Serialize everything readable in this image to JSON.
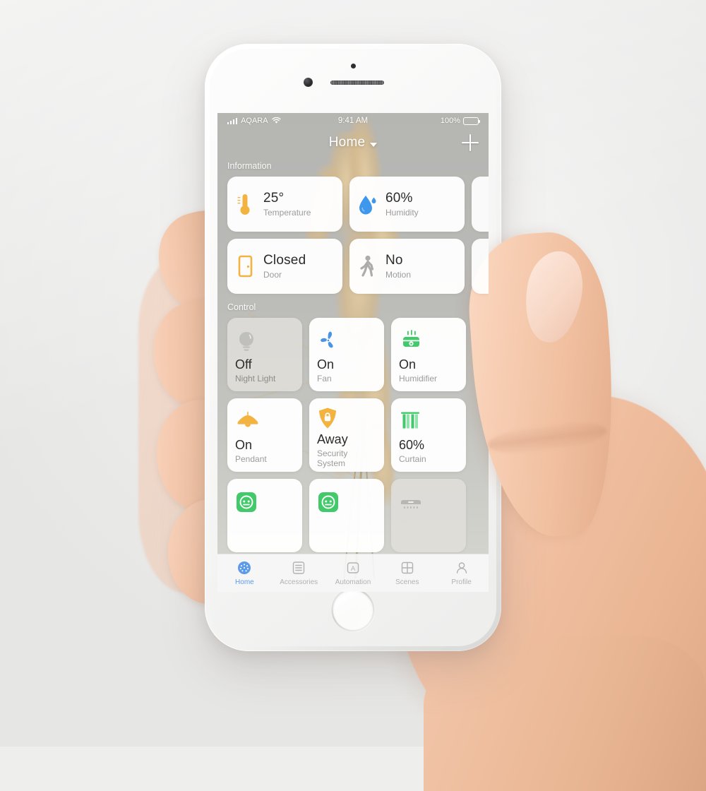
{
  "scene": {
    "device": "iphone-in-hand",
    "description": "Hand holding a white iPhone displaying the Aqara Home smart-home app"
  },
  "status_bar": {
    "carrier": "AQARA",
    "wifi_icon": "wifi-icon",
    "signal_icon": "signal-bars-icon",
    "time": "9:41 AM",
    "battery_percent": "100%",
    "battery_icon": "battery-full-icon"
  },
  "nav_bar": {
    "title": "Home",
    "caret_icon": "chevron-down-icon",
    "add_icon": "plus-icon"
  },
  "sections": [
    {
      "key": "information",
      "label": "Information",
      "rows": [
        [
          {
            "icon": "thermometer-icon",
            "color": "#F3B340",
            "value": "25°",
            "label": "Temperature"
          },
          {
            "icon": "water-drop-icon",
            "color": "#3C97ED",
            "value": "60%",
            "label": "Humidity"
          }
        ],
        [
          {
            "icon": "door-icon",
            "color": "#F3B340",
            "value": "Closed",
            "label": "Door"
          },
          {
            "icon": "motion-walking-icon",
            "color": "#ACACAC",
            "value": "No",
            "label": "Motion"
          }
        ]
      ]
    },
    {
      "key": "control",
      "label": "Control",
      "rows": [
        [
          {
            "icon": "light-bulb-icon",
            "color": "#BFBFBC",
            "value": "Off",
            "label": "Night Light",
            "state": "off"
          },
          {
            "icon": "fan-icon",
            "color": "#4A94E8",
            "value": "On",
            "label": "Fan",
            "state": "on"
          },
          {
            "icon": "humidifier-icon",
            "color": "#41C96A",
            "value": "On",
            "label": "Humidifier",
            "state": "on"
          }
        ],
        [
          {
            "icon": "pendant-lamp-icon",
            "color": "#F3B340",
            "value": "On",
            "label": "Pendant",
            "state": "on"
          },
          {
            "icon": "shield-lock-icon",
            "color": "#F3B340",
            "value": "Away",
            "label": "Security System",
            "state": "on"
          },
          {
            "icon": "curtain-icon",
            "color": "#41C96A",
            "value": "60%",
            "label": "Curtain",
            "state": "on"
          }
        ],
        [
          {
            "icon": "power-outlet-icon",
            "color": "#41C96A",
            "value": "",
            "label": "",
            "state": "on"
          },
          {
            "icon": "power-outlet-icon",
            "color": "#41C96A",
            "value": "",
            "label": "",
            "state": "on"
          },
          {
            "icon": "gateway-hub-icon",
            "color": "#B7B7B4",
            "value": "",
            "label": "",
            "state": "off"
          }
        ]
      ]
    }
  ],
  "tab_bar": {
    "active": "Home",
    "tabs": [
      {
        "label": "Home",
        "icon": "home-dots-icon",
        "active": true
      },
      {
        "label": "Accessories",
        "icon": "list-lines-icon",
        "active": false
      },
      {
        "label": "Automation",
        "icon": "letter-a-box-icon",
        "active": false
      },
      {
        "label": "Scenes",
        "icon": "grid-four-icon",
        "active": false
      },
      {
        "label": "Profile",
        "icon": "person-icon",
        "active": false
      }
    ]
  },
  "colors": {
    "accent_blue": "#5D9AE8",
    "amber": "#F3B340",
    "green": "#41C96A",
    "droplet_blue": "#3C97ED",
    "inactive_gray": "#B2B2B2",
    "card_white": "#FFFFFF",
    "wallpaper_gray": "#B9B9B6",
    "pampas_tan": "#D9C193"
  }
}
